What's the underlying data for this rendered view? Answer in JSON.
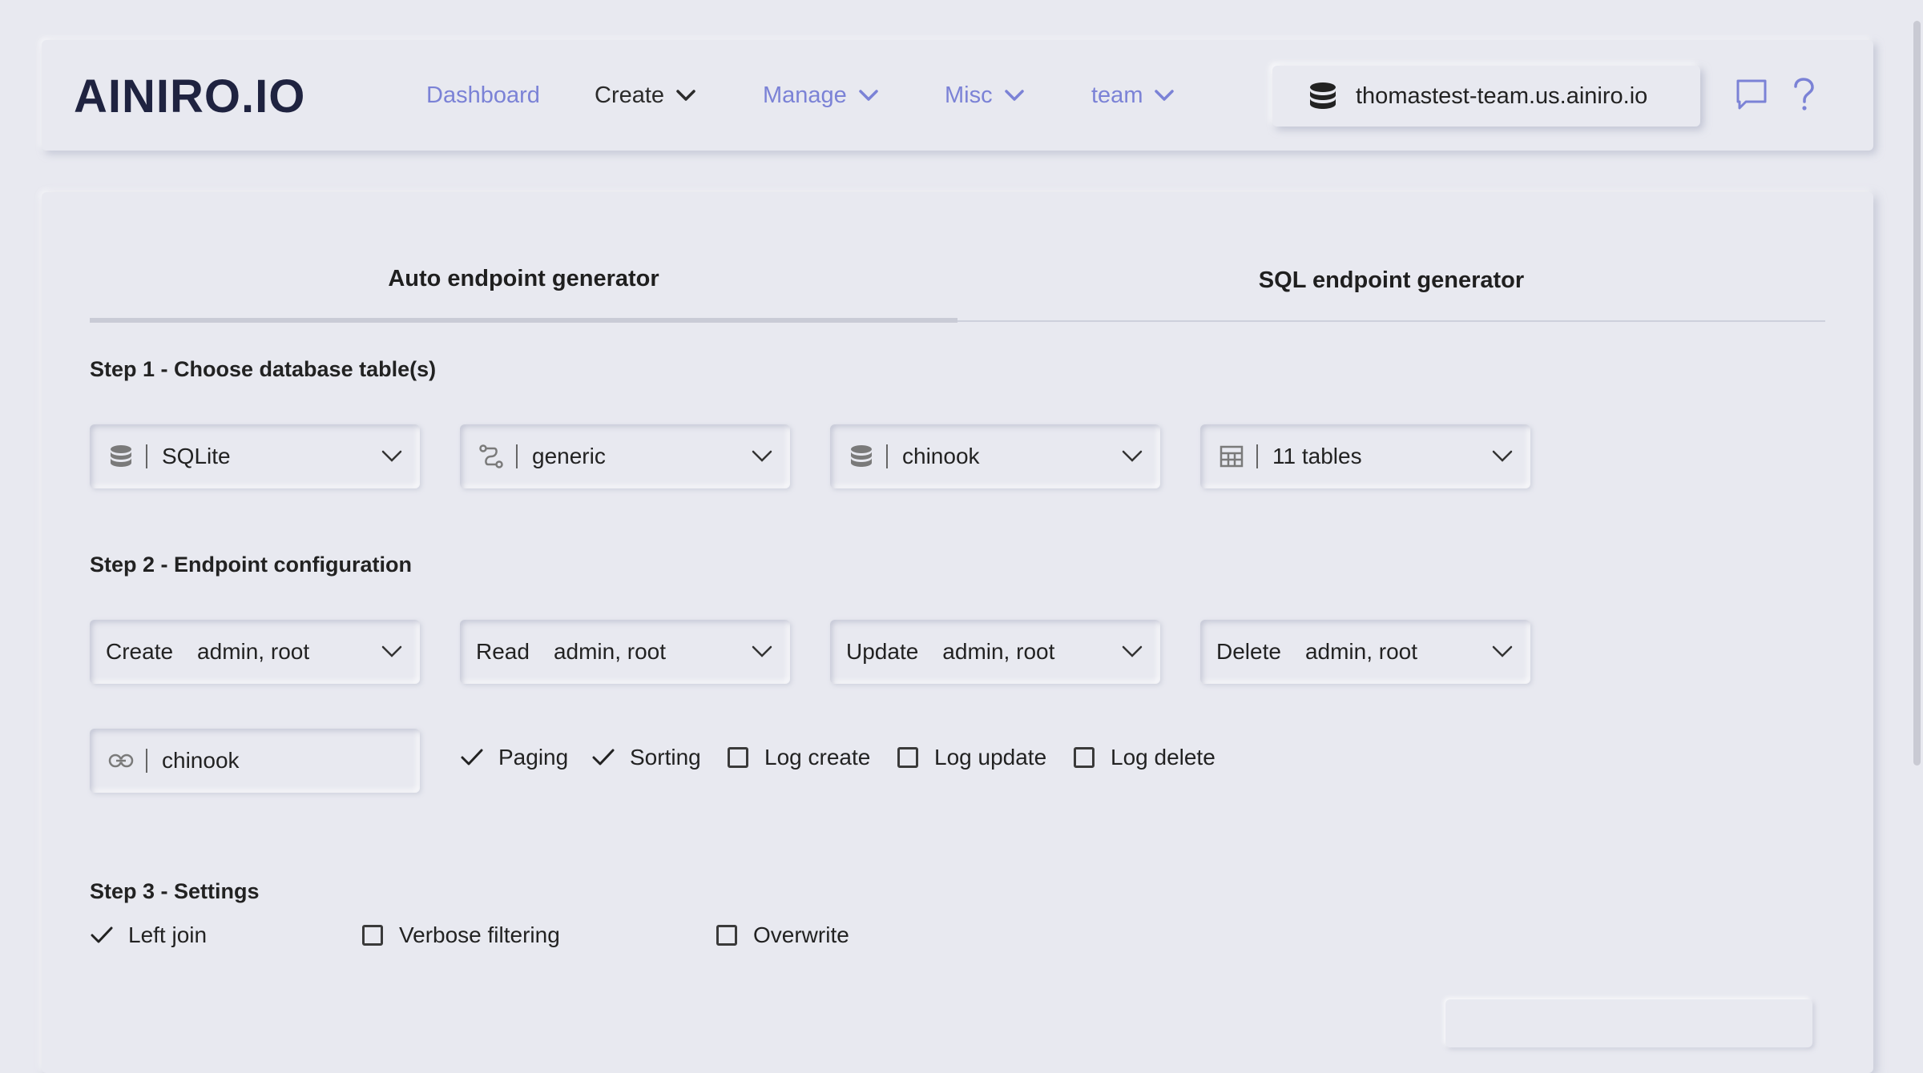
{
  "nav": {
    "brand": "AINIRO.IO",
    "items": [
      {
        "label": "Dashboard",
        "has_caret": false
      },
      {
        "label": "Create",
        "has_caret": true
      },
      {
        "label": "Manage",
        "has_caret": true
      },
      {
        "label": "Misc",
        "has_caret": true
      },
      {
        "label": "team",
        "has_caret": true
      }
    ],
    "site": "thomastest-team.us.ainiro.io",
    "chat_icon": "chat-icon",
    "help_icon": "question-icon"
  },
  "tabs": [
    {
      "label": "Auto endpoint generator",
      "active": true
    },
    {
      "label": "SQL endpoint generator",
      "active": false
    }
  ],
  "step1": {
    "title": "Step 1 - Choose database table(s)",
    "selects": [
      {
        "icon": "database-icon",
        "value": "SQLite"
      },
      {
        "icon": "connection-icon",
        "value": "generic"
      },
      {
        "icon": "database-icon",
        "value": "chinook"
      },
      {
        "icon": "table-icon",
        "value": "11 tables"
      }
    ]
  },
  "step2": {
    "title": "Step 2 - Endpoint configuration",
    "verbs": [
      {
        "label": "Create",
        "value": "admin, root"
      },
      {
        "label": "Read",
        "value": "admin, root"
      },
      {
        "label": "Update",
        "value": "admin, root"
      },
      {
        "label": "Delete",
        "value": "admin, root"
      }
    ],
    "url_input": {
      "icon": "link-icon",
      "value": "chinook"
    },
    "options": [
      {
        "label": "Paging",
        "checked": true
      },
      {
        "label": "Sorting",
        "checked": true
      },
      {
        "label": "Log create",
        "checked": false
      },
      {
        "label": "Log update",
        "checked": false
      },
      {
        "label": "Log delete",
        "checked": false
      }
    ]
  },
  "step3": {
    "title": "Step 3 - Settings",
    "options": [
      {
        "label": "Left join",
        "checked": true
      },
      {
        "label": "Verbose filtering",
        "checked": false
      },
      {
        "label": "Overwrite",
        "checked": false
      }
    ]
  },
  "colors": {
    "background": "#e8e9f0",
    "link": "#7b82d6",
    "logo": "#1f2340"
  }
}
